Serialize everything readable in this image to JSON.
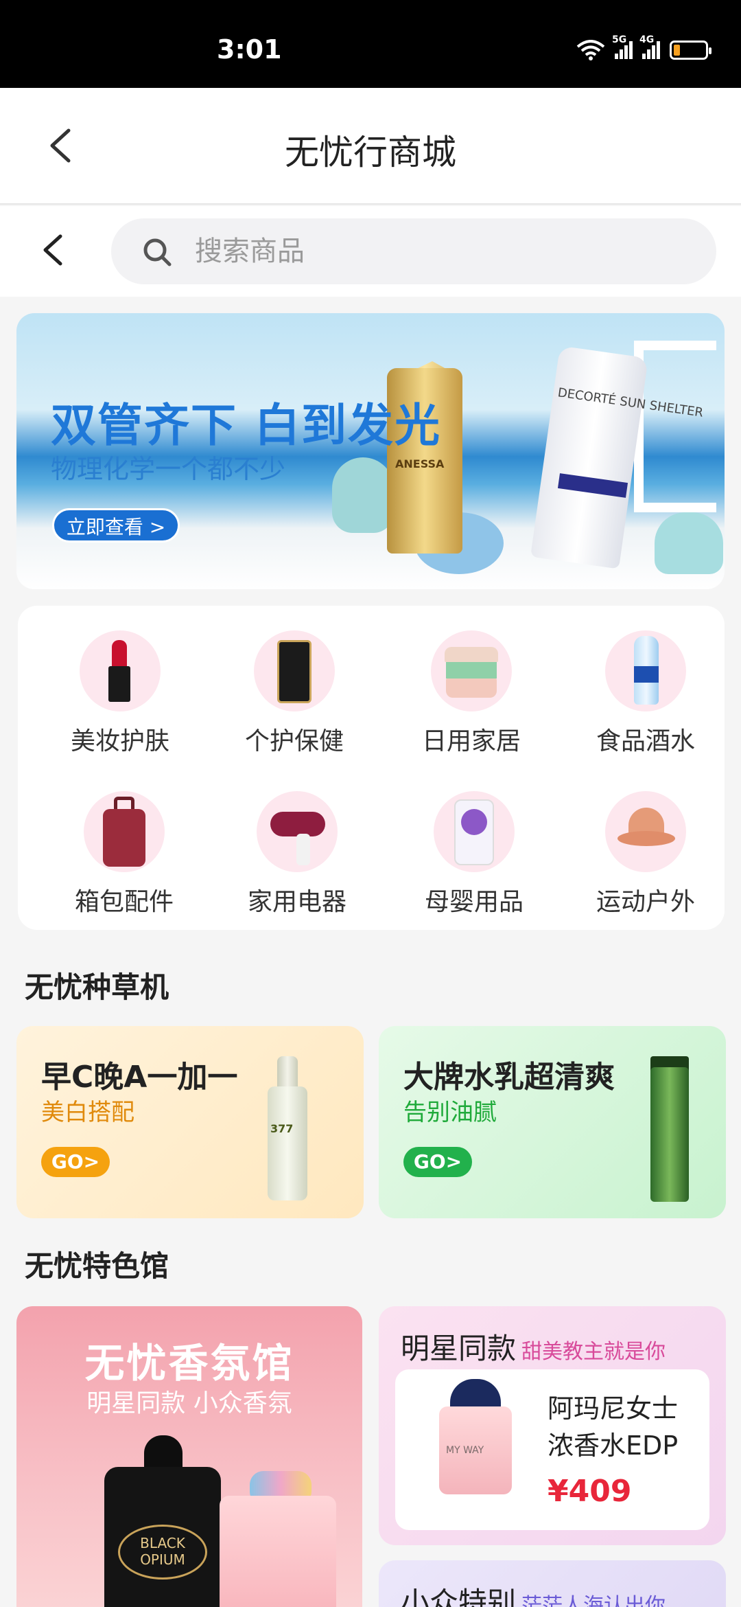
{
  "status_bar": {
    "time": "3:01",
    "net1": "5G",
    "net2": "4G",
    "battery_level": 0.2,
    "battery_color": "#f6a020"
  },
  "header": {
    "title": "无忧行商城",
    "back_icon": "chevron-left-icon"
  },
  "search": {
    "placeholder": "搜索商品",
    "icon": "search-icon"
  },
  "banner": {
    "title": "双管齐下 白到发光",
    "subtitle": "物理化学一个都不少",
    "button": "立即查看 >",
    "product1_label": "ANESSA",
    "product2_label": "DECORTÉ SUN SHELTER",
    "accent": "#1f78d8"
  },
  "categories": [
    {
      "label": "美妆护肤",
      "icon": "lipstick-icon"
    },
    {
      "label": "个护保健",
      "icon": "shampoo-icon"
    },
    {
      "label": "日用家居",
      "icon": "steamer-icon"
    },
    {
      "label": "食品酒水",
      "icon": "water-bottle-icon"
    },
    {
      "label": "箱包配件",
      "icon": "suitcase-icon"
    },
    {
      "label": "家用电器",
      "icon": "hair-dryer-icon"
    },
    {
      "label": "母婴用品",
      "icon": "milk-powder-icon"
    },
    {
      "label": "运动户外",
      "icon": "sun-hat-icon"
    }
  ],
  "grass_section": {
    "title": "无忧种草机",
    "cards": [
      {
        "title": "早C晚A一加一",
        "subtitle": "美白搭配",
        "button": "GO>",
        "product_label": "377"
      },
      {
        "title": "大牌水乳超清爽",
        "subtitle": "告别油腻",
        "button": "GO>"
      }
    ]
  },
  "feature_section": {
    "title": "无忧特色馆",
    "big_card": {
      "title": "无忧香氛馆",
      "subtitle": "明星同款 小众香氛",
      "product_label": "BLACK OPIUM"
    },
    "star_card": {
      "title": "明星同款",
      "tag": "甜美教主就是你",
      "product_name": "阿玛尼女士浓香水EDP",
      "price": "¥409",
      "product_label": "MY WAY"
    },
    "niche_card": {
      "title": "小众特别",
      "tag": "茫茫人海认出你"
    }
  }
}
